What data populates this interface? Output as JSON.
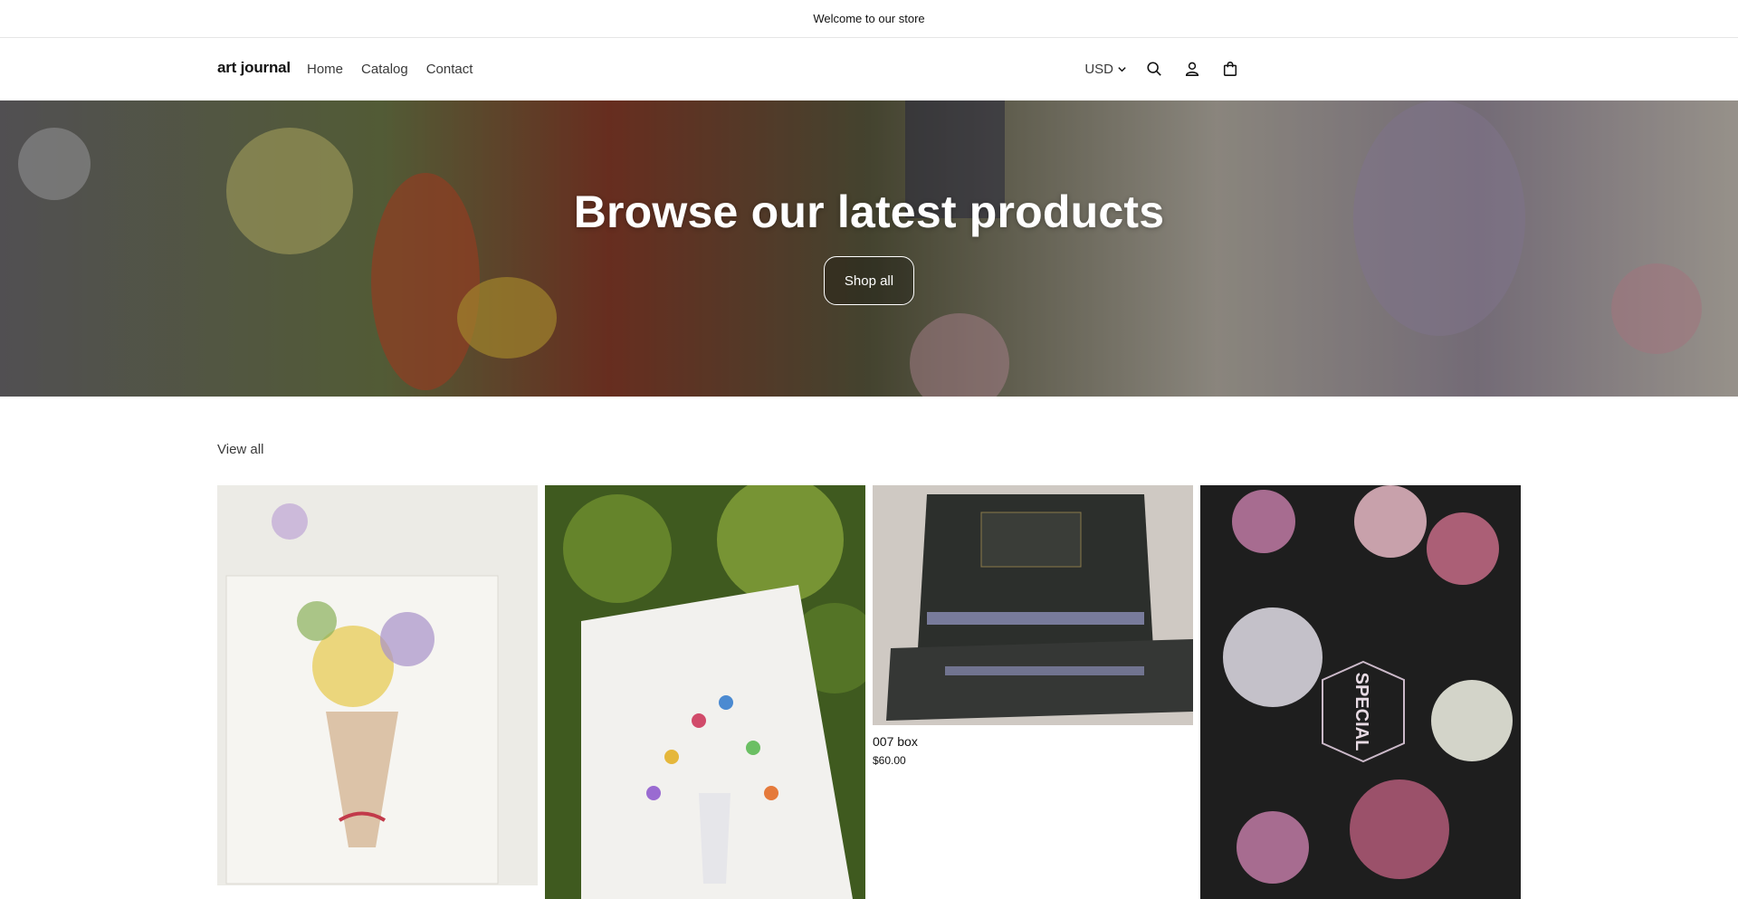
{
  "announcement": {
    "text": "Welcome to our store"
  },
  "header": {
    "logo": "art journal",
    "nav": [
      "Home",
      "Catalog",
      "Contact"
    ],
    "currency": "USD",
    "icons": [
      "search-icon",
      "account-icon",
      "cart-icon"
    ]
  },
  "hero": {
    "title": "Browse our latest products",
    "button": "Shop all"
  },
  "collection": {
    "view_all": "View all",
    "products": [
      {
        "title": "",
        "price": ""
      },
      {
        "title": "",
        "price": ""
      },
      {
        "title": "007 box",
        "price": "$60.00"
      },
      {
        "title": "",
        "price": ""
      }
    ]
  },
  "colors": {
    "text": "#121212",
    "muted": "#3a3a3a",
    "border": "#e6e6e6"
  }
}
